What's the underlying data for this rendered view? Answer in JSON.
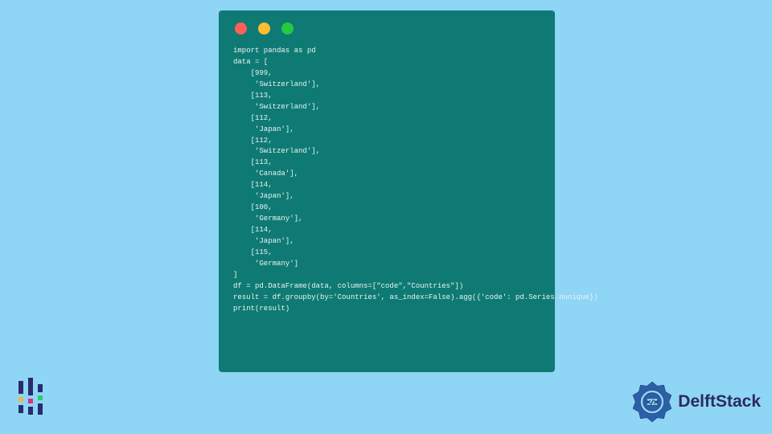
{
  "window": {
    "traffic_lights": [
      "red",
      "yellow",
      "green"
    ]
  },
  "code": {
    "text": "import pandas as pd\ndata = [\n    [999,\n     'Switzerland'],\n    [113,\n     'Switzerland'],\n    [112,\n     'Japan'],\n    [112,\n     'Switzerland'],\n    [113,\n     'Canada'],\n    [114,\n     'Japan'],\n    [100,\n     'Germany'],\n    [114,\n     'Japan'],\n    [115,\n     'Germany']\n]\ndf = pd.DataFrame(data, columns=[\"code\",\"Countries\"])\nresult = df.groupby(by='Countries', as_index=False).agg({'code': pd.Series.nunique})\nprint(result)"
  },
  "brand": {
    "name": "DelftStack"
  }
}
